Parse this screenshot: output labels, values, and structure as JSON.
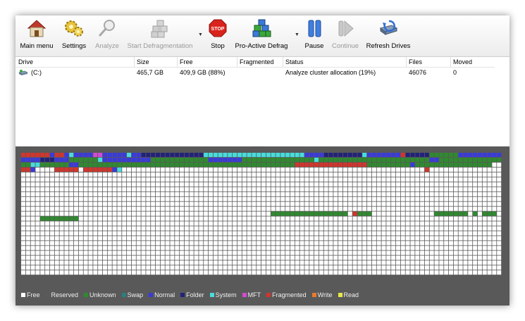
{
  "toolbar": {
    "main_menu": "Main menu",
    "settings": "Settings",
    "analyze": "Analyze",
    "start_defrag": "Start Defragmentation",
    "stop": "Stop",
    "stop_sign": "STOP",
    "proactive": "Pro-Active Defrag",
    "pause": "Pause",
    "continue": "Continue",
    "refresh": "Refresh Drives"
  },
  "icons": {
    "main_menu": "house-icon",
    "settings": "gears-icon",
    "analyze": "magnifier-icon",
    "start_defrag": "cubes-icon",
    "stop": "stop-sign-icon",
    "proactive": "blocks-icon",
    "pause": "pause-icon",
    "continue": "play-icon",
    "refresh": "drive-refresh-icon"
  },
  "table": {
    "headers": {
      "drive": "Drive",
      "size": "Size",
      "free": "Free",
      "fragmented": "Fragmented",
      "status": "Status",
      "files": "Files",
      "moved": "Moved"
    },
    "rows": [
      {
        "drive": "(C:)",
        "size": "465,7 GB",
        "free": "409,9 GB (88%)",
        "fragmented": "",
        "status": "Analyze cluster allocation (19%)",
        "files": "46076",
        "moved": "0"
      }
    ]
  },
  "legend": [
    {
      "label": "Free",
      "color": "#ffffff"
    },
    {
      "label": "Reserved",
      "color": "#5a5a5a"
    },
    {
      "label": "Unknown",
      "color": "#2f8a2f"
    },
    {
      "label": "Swap",
      "color": "#2a7f7f"
    },
    {
      "label": "Normal",
      "color": "#3a3adc"
    },
    {
      "label": "Folder",
      "color": "#22227a"
    },
    {
      "label": "System",
      "color": "#48dcdc"
    },
    {
      "label": "MFT",
      "color": "#d24ad2"
    },
    {
      "label": "Fragmented",
      "color": "#d2352c"
    },
    {
      "label": "Write",
      "color": "#e87a2a"
    },
    {
      "label": "Read",
      "color": "#e8e84a"
    }
  ]
}
